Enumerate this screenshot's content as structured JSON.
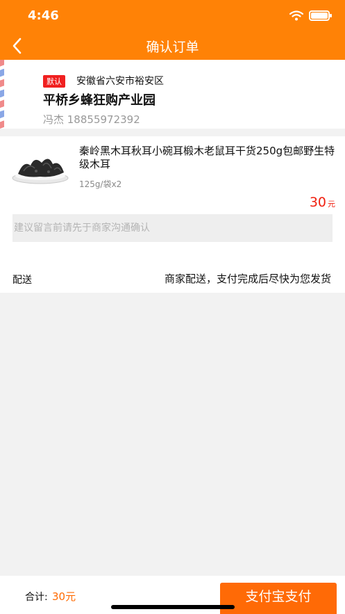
{
  "status_bar": {
    "time": "4:46"
  },
  "nav": {
    "title": "确认订单"
  },
  "address": {
    "tag": "默认",
    "region": "安徽省六安市裕安区",
    "detail": "平桥乡蜂狂购产业园",
    "contact": "冯杰 18855972392"
  },
  "product": {
    "title": "秦岭黑木耳秋耳小碗耳椴木老鼠耳干货250g包邮野生特级木耳",
    "spec": "125g/袋x2",
    "price": "30",
    "price_unit": "元"
  },
  "memo": {
    "placeholder": "建议留言前请先于商家沟通确认"
  },
  "delivery": {
    "label": "配送",
    "value": "商家配送，支付完成后尽快为您发货"
  },
  "footer": {
    "total_label": "合计:",
    "total_value": "30元",
    "pay_label": "支付宝支付"
  },
  "colors": {
    "accent": "#ff8206",
    "price": "#f02010",
    "tag": "#f02020"
  },
  "icons": {
    "back": "chevron-left-icon",
    "wifi": "wifi-icon",
    "battery": "battery-icon"
  }
}
